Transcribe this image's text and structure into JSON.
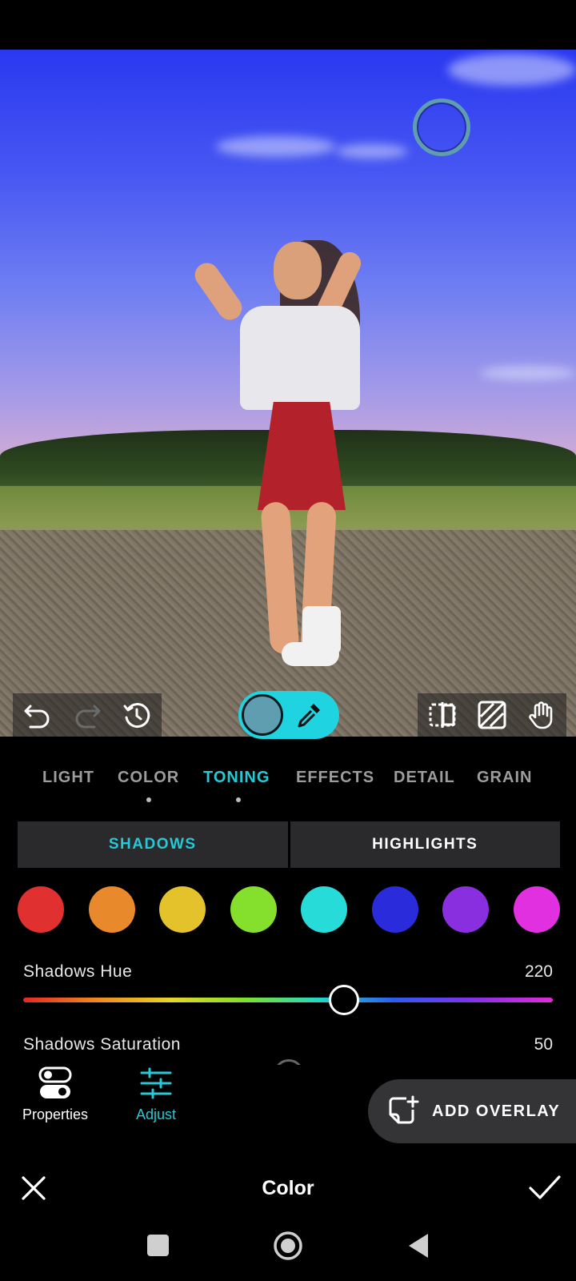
{
  "editor": {
    "tabs": [
      {
        "label": "LIGHT",
        "active": false,
        "has_dot": false
      },
      {
        "label": "COLOR",
        "active": false,
        "has_dot": true
      },
      {
        "label": "TONING",
        "active": true,
        "has_dot": true
      },
      {
        "label": "EFFECTS",
        "active": false,
        "has_dot": false
      },
      {
        "label": "DETAIL",
        "active": false,
        "has_dot": false
      },
      {
        "label": "GRAIN",
        "active": false,
        "has_dot": false
      }
    ],
    "segments": {
      "shadows": "SHADOWS",
      "highlights": "HIGHLIGHTS",
      "active": "shadows"
    },
    "swatches": [
      "#e03030",
      "#e8892c",
      "#e3c22c",
      "#84e02c",
      "#27dcd8",
      "#2a2cdc",
      "#8a2fe0",
      "#e030e0"
    ],
    "sliders": {
      "hue": {
        "label": "Shadows Hue",
        "value": "220",
        "fraction": 0.606
      },
      "saturation": {
        "label": "Shadows Saturation",
        "value": "50"
      }
    },
    "picked_color": "#5f9db0",
    "accent_color": "#27c9d6"
  },
  "bottom_tools": {
    "properties_label": "Properties",
    "adjust_label": "Adjust",
    "add_overlay_label": "ADD OVERLAY"
  },
  "action_bar": {
    "title": "Color",
    "cancel_icon": "close-icon",
    "confirm_icon": "check-icon"
  },
  "toolbar_icons": [
    "undo-icon",
    "redo-icon",
    "history-icon",
    "compare-split-icon",
    "mask-icon",
    "pan-hand-icon",
    "eyedropper-icon"
  ],
  "system_nav": [
    "recents-icon",
    "home-icon",
    "back-icon"
  ]
}
